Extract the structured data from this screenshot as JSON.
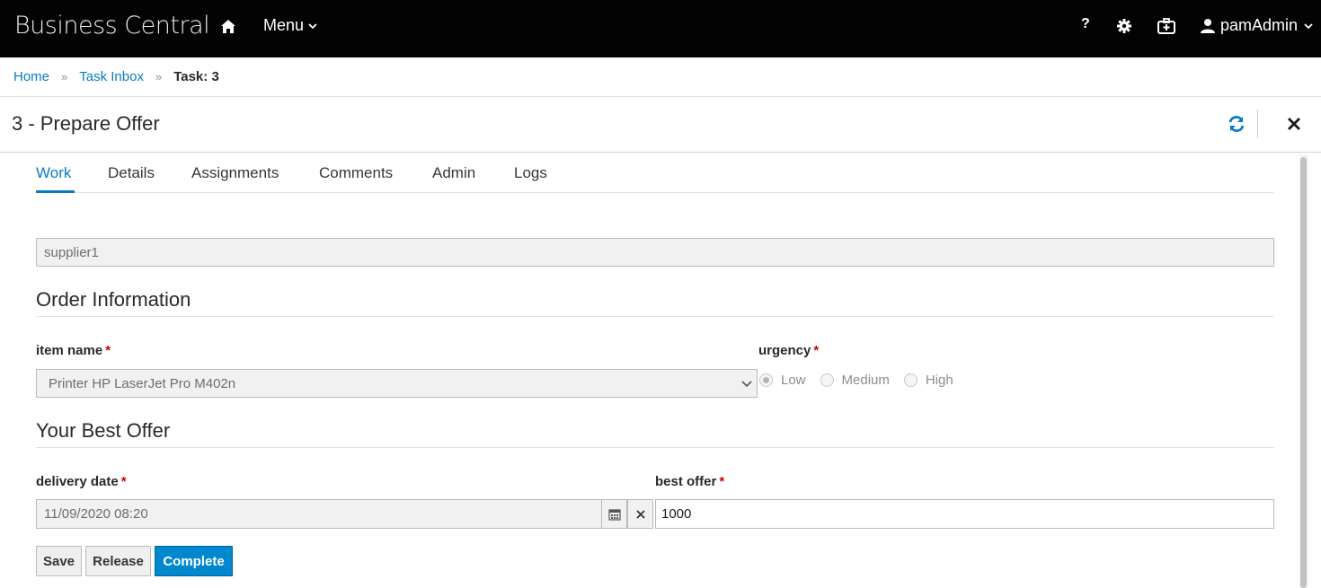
{
  "header": {
    "brand": "Business Central",
    "home_icon": "home-icon",
    "menu_label": "Menu",
    "help_label": "?",
    "user_label": "pamAdmin"
  },
  "breadcrumb": {
    "items": [
      "Home",
      "Task Inbox"
    ],
    "current": "Task: 3"
  },
  "task": {
    "title": "3 - Prepare Offer"
  },
  "tabs": [
    "Work",
    "Details",
    "Assignments",
    "Comments",
    "Admin",
    "Logs"
  ],
  "active_tab": "Work",
  "form": {
    "supplier_value": "supplier1",
    "order_section": "Order Information",
    "item_name_label": "item name",
    "item_name_value": "Printer HP LaserJet Pro M402n",
    "urgency_label": "urgency",
    "urgency_options": [
      "Low",
      "Medium",
      "High"
    ],
    "urgency_selected": "Low",
    "offer_section": "Your Best Offer",
    "delivery_date_label": "delivery date",
    "delivery_date_value": "11/09/2020 08:20",
    "best_offer_label": "best offer",
    "best_offer_value": "1000",
    "required_marker": "*"
  },
  "actions": {
    "save": "Save",
    "release": "Release",
    "complete": "Complete"
  },
  "colors": {
    "accent": "#0b7bbe",
    "primary_button": "#0088ce",
    "header_bg": "#030303",
    "required": "#cc0000"
  }
}
